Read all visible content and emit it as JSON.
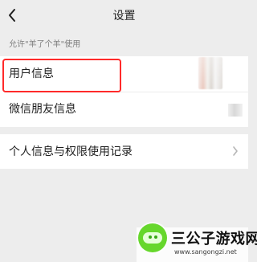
{
  "nav": {
    "title": "设置",
    "back_icon": "chevron-left-icon"
  },
  "section": {
    "caption": "允许\"羊了个羊\"使用"
  },
  "rows": [
    {
      "label": "用户信息"
    },
    {
      "label": "微信朋友信息"
    }
  ],
  "privacy": {
    "label": "个人信息与权限使用记录",
    "chevron_icon": "chevron-right-icon"
  },
  "watermark": {
    "title": "三公子游戏网",
    "url": "www.sangongzi.net"
  },
  "colors": {
    "background": "#ededed",
    "card": "#ffffff",
    "text": "#1f1f1f",
    "caption": "#7d7d7d",
    "highlight": "#ff2a2a",
    "logo": "#66d72c"
  }
}
